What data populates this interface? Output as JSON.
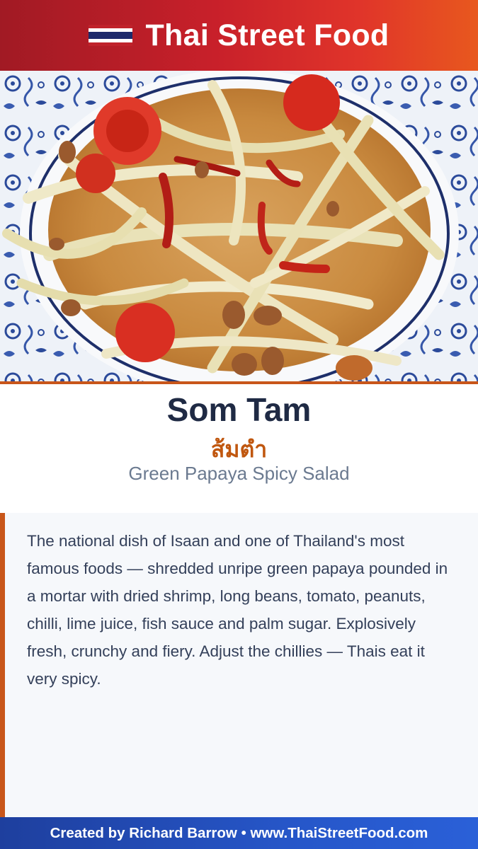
{
  "header": {
    "title": "Thai Street Food",
    "flag_icon": "thai-flag-icon"
  },
  "photo": {
    "subject": "green papaya salad on blue and white plate"
  },
  "dish": {
    "name": "Som Tam",
    "thai_name": "ส้มตำ",
    "english_name": "Green Papaya Spicy Salad"
  },
  "description": {
    "text": "The national dish of Isaan and one of Thailand's most famous foods — shredded unripe green papaya pounded in a mortar with dried shrimp, long beans, tomato, peanuts, chilli, lime juice, fish sauce and palm sugar. Explosively fresh, crunchy and fiery. Adjust the chillies — Thais eat it very spicy."
  },
  "footer": {
    "credit": "Created by Richard Barrow • www.ThaiStreetFood.com"
  },
  "colors": {
    "header_red": "#c8202a",
    "accent_orange": "#c8561a",
    "footer_blue": "#2656c8",
    "title_navy": "#1f2a44"
  }
}
